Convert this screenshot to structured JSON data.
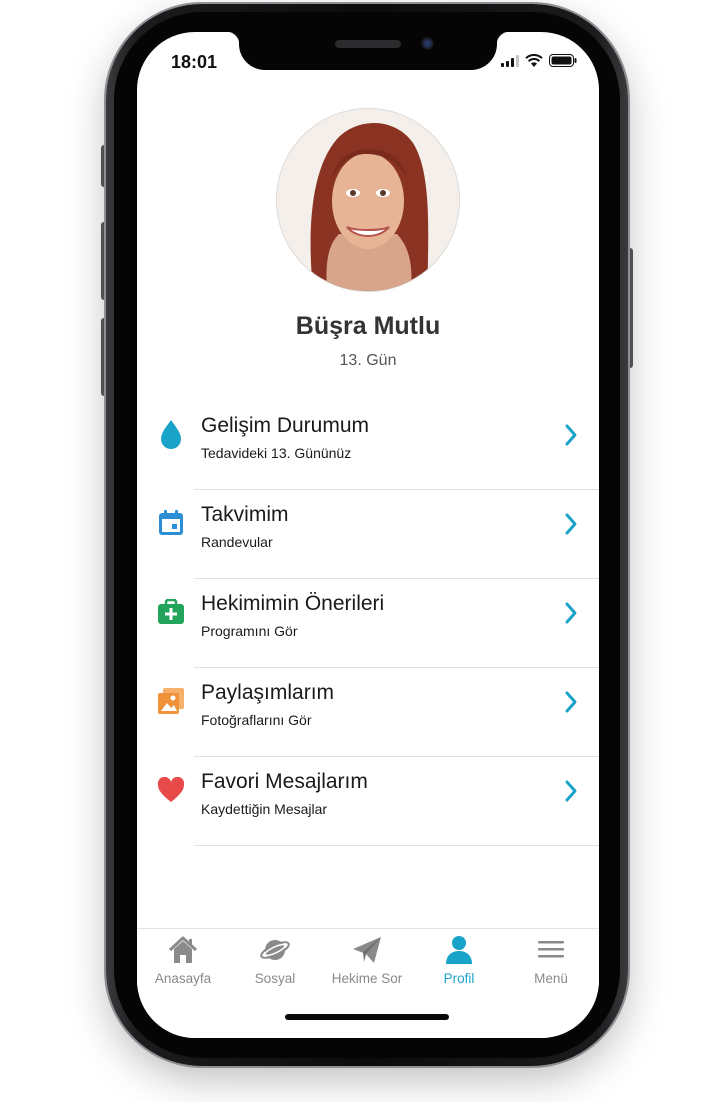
{
  "status": {
    "time": "18:01"
  },
  "profile": {
    "name": "Büşra Mutlu",
    "day": "13. Gün"
  },
  "menu": [
    {
      "title": "Gelişim Durumum",
      "subtitle": "Tedavideki 13. Gününüz",
      "icon": "drop-icon",
      "color": "#1aa3c8"
    },
    {
      "title": "Takvimim",
      "subtitle": "Randevular",
      "icon": "calendar-icon",
      "color": "#2c8fd6"
    },
    {
      "title": "Hekimimin Önerileri",
      "subtitle": "Programını Gör",
      "icon": "medical-kit-icon",
      "color": "#22a55a"
    },
    {
      "title": "Paylaşımlarım",
      "subtitle": "Fotoğraflarını Gör",
      "icon": "photos-icon",
      "color": "#f0923a"
    },
    {
      "title": "Favori Mesajlarım",
      "subtitle": "Kaydettiğin Mesajlar",
      "icon": "heart-icon",
      "color": "#e84a4a"
    }
  ],
  "accent_color": "#1aa3c8",
  "tabs": [
    {
      "label": "Anasayfa",
      "icon": "home-icon",
      "active": false
    },
    {
      "label": "Sosyal",
      "icon": "planet-icon",
      "active": false
    },
    {
      "label": "Hekime Sor",
      "icon": "paper-plane-icon",
      "active": false
    },
    {
      "label": "Profil",
      "icon": "user-icon",
      "active": true
    },
    {
      "label": "Menü",
      "icon": "hamburger-menu-icon",
      "active": false
    }
  ]
}
